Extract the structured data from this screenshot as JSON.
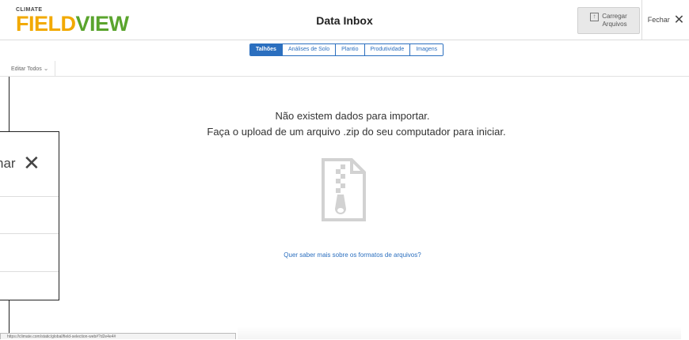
{
  "header": {
    "logo_small": "CLIMATE",
    "logo_big_f": "F",
    "logo_big_rest": "IELD",
    "logo_big_v": "VIEW",
    "title": "Data Inbox",
    "upload_label": "Carregar Arquivos",
    "close_label": "Fechar"
  },
  "tabs": [
    {
      "label": "Talhões",
      "active": true
    },
    {
      "label": "Análises de Solo",
      "active": false
    },
    {
      "label": "Plantio",
      "active": false
    },
    {
      "label": "Produtividade",
      "active": false
    },
    {
      "label": "Imagens",
      "active": false
    }
  ],
  "toolbar": {
    "edit_all": "Editar Todos"
  },
  "empty_state": {
    "line1": "Não existem dados para importar.",
    "line2": "Faça o upload de um arquivo .zip do seu computador para iniciar.",
    "link": "Quer saber mais sobre os formatos de arquivos?"
  },
  "popup": {
    "title_fragment": "har"
  },
  "statusbar": {
    "url": "https://climate.com/static/global/field-selection-web#?d2e4e4#"
  },
  "colors": {
    "accent": "#2b6fbf",
    "logo_orange": "#f2a900",
    "logo_green": "#5aa42d"
  }
}
